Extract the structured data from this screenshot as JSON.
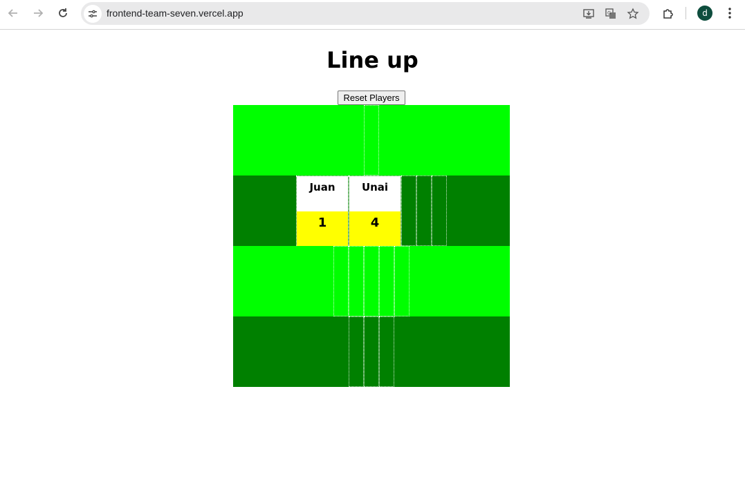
{
  "browser": {
    "url": "frontend-team-seven.vercel.app",
    "profile_initial": "d",
    "icons": [
      "back-icon",
      "forward-icon",
      "reload-icon",
      "site-info-icon",
      "install-app-icon",
      "translate-icon",
      "bookmark-star-icon",
      "extensions-icon",
      "more-menu-icon"
    ]
  },
  "page": {
    "title": "Line up",
    "reset_label": "Reset Players"
  },
  "colors": {
    "light_green": "#00ff00",
    "dark_green": "#008000",
    "number_bg": "#ffff00",
    "name_bg": "#ffffff"
  },
  "lineup": {
    "rows": [
      {
        "name": "row-1",
        "color": "light_green",
        "empty_slots": 1,
        "players": []
      },
      {
        "name": "row-2",
        "color": "dark_green",
        "empty_slots": 3,
        "players": [
          {
            "name": "Juan",
            "number": "1"
          },
          {
            "name": "Unai",
            "number": "4"
          }
        ]
      },
      {
        "name": "row-3",
        "color": "light_green",
        "empty_slots": 5,
        "players": []
      },
      {
        "name": "row-4",
        "color": "dark_green",
        "empty_slots": 3,
        "players": []
      }
    ]
  }
}
